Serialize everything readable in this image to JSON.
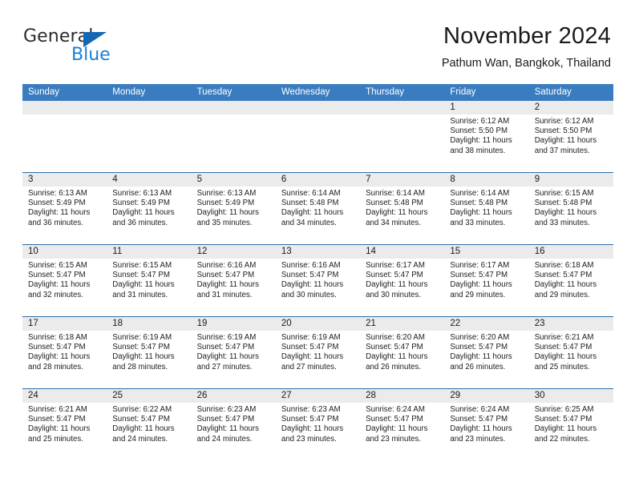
{
  "brand": {
    "name_top": "General",
    "name_bottom": "Blue",
    "accent_color": "#1b7fd4",
    "triangle_color": "#1268b3"
  },
  "header": {
    "title": "November 2024",
    "subtitle": "Pathum Wan, Bangkok, Thailand"
  },
  "calendar": {
    "header_bg": "#3a7cc0",
    "daynum_bg": "#ebebeb",
    "weekdays": [
      "Sunday",
      "Monday",
      "Tuesday",
      "Wednesday",
      "Thursday",
      "Friday",
      "Saturday"
    ],
    "weeks": [
      [
        {
          "day": "",
          "empty": true,
          "sunrise": "",
          "sunset": "",
          "daylight": ""
        },
        {
          "day": "",
          "empty": true,
          "sunrise": "",
          "sunset": "",
          "daylight": ""
        },
        {
          "day": "",
          "empty": true,
          "sunrise": "",
          "sunset": "",
          "daylight": ""
        },
        {
          "day": "",
          "empty": true,
          "sunrise": "",
          "sunset": "",
          "daylight": ""
        },
        {
          "day": "",
          "empty": true,
          "sunrise": "",
          "sunset": "",
          "daylight": ""
        },
        {
          "day": "1",
          "empty": false,
          "sunrise": "Sunrise: 6:12 AM",
          "sunset": "Sunset: 5:50 PM",
          "daylight": "Daylight: 11 hours and 38 minutes."
        },
        {
          "day": "2",
          "empty": false,
          "sunrise": "Sunrise: 6:12 AM",
          "sunset": "Sunset: 5:50 PM",
          "daylight": "Daylight: 11 hours and 37 minutes."
        }
      ],
      [
        {
          "day": "3",
          "empty": false,
          "sunrise": "Sunrise: 6:13 AM",
          "sunset": "Sunset: 5:49 PM",
          "daylight": "Daylight: 11 hours and 36 minutes."
        },
        {
          "day": "4",
          "empty": false,
          "sunrise": "Sunrise: 6:13 AM",
          "sunset": "Sunset: 5:49 PM",
          "daylight": "Daylight: 11 hours and 36 minutes."
        },
        {
          "day": "5",
          "empty": false,
          "sunrise": "Sunrise: 6:13 AM",
          "sunset": "Sunset: 5:49 PM",
          "daylight": "Daylight: 11 hours and 35 minutes."
        },
        {
          "day": "6",
          "empty": false,
          "sunrise": "Sunrise: 6:14 AM",
          "sunset": "Sunset: 5:48 PM",
          "daylight": "Daylight: 11 hours and 34 minutes."
        },
        {
          "day": "7",
          "empty": false,
          "sunrise": "Sunrise: 6:14 AM",
          "sunset": "Sunset: 5:48 PM",
          "daylight": "Daylight: 11 hours and 34 minutes."
        },
        {
          "day": "8",
          "empty": false,
          "sunrise": "Sunrise: 6:14 AM",
          "sunset": "Sunset: 5:48 PM",
          "daylight": "Daylight: 11 hours and 33 minutes."
        },
        {
          "day": "9",
          "empty": false,
          "sunrise": "Sunrise: 6:15 AM",
          "sunset": "Sunset: 5:48 PM",
          "daylight": "Daylight: 11 hours and 33 minutes."
        }
      ],
      [
        {
          "day": "10",
          "empty": false,
          "sunrise": "Sunrise: 6:15 AM",
          "sunset": "Sunset: 5:47 PM",
          "daylight": "Daylight: 11 hours and 32 minutes."
        },
        {
          "day": "11",
          "empty": false,
          "sunrise": "Sunrise: 6:15 AM",
          "sunset": "Sunset: 5:47 PM",
          "daylight": "Daylight: 11 hours and 31 minutes."
        },
        {
          "day": "12",
          "empty": false,
          "sunrise": "Sunrise: 6:16 AM",
          "sunset": "Sunset: 5:47 PM",
          "daylight": "Daylight: 11 hours and 31 minutes."
        },
        {
          "day": "13",
          "empty": false,
          "sunrise": "Sunrise: 6:16 AM",
          "sunset": "Sunset: 5:47 PM",
          "daylight": "Daylight: 11 hours and 30 minutes."
        },
        {
          "day": "14",
          "empty": false,
          "sunrise": "Sunrise: 6:17 AM",
          "sunset": "Sunset: 5:47 PM",
          "daylight": "Daylight: 11 hours and 30 minutes."
        },
        {
          "day": "15",
          "empty": false,
          "sunrise": "Sunrise: 6:17 AM",
          "sunset": "Sunset: 5:47 PM",
          "daylight": "Daylight: 11 hours and 29 minutes."
        },
        {
          "day": "16",
          "empty": false,
          "sunrise": "Sunrise: 6:18 AM",
          "sunset": "Sunset: 5:47 PM",
          "daylight": "Daylight: 11 hours and 29 minutes."
        }
      ],
      [
        {
          "day": "17",
          "empty": false,
          "sunrise": "Sunrise: 6:18 AM",
          "sunset": "Sunset: 5:47 PM",
          "daylight": "Daylight: 11 hours and 28 minutes."
        },
        {
          "day": "18",
          "empty": false,
          "sunrise": "Sunrise: 6:19 AM",
          "sunset": "Sunset: 5:47 PM",
          "daylight": "Daylight: 11 hours and 28 minutes."
        },
        {
          "day": "19",
          "empty": false,
          "sunrise": "Sunrise: 6:19 AM",
          "sunset": "Sunset: 5:47 PM",
          "daylight": "Daylight: 11 hours and 27 minutes."
        },
        {
          "day": "20",
          "empty": false,
          "sunrise": "Sunrise: 6:19 AM",
          "sunset": "Sunset: 5:47 PM",
          "daylight": "Daylight: 11 hours and 27 minutes."
        },
        {
          "day": "21",
          "empty": false,
          "sunrise": "Sunrise: 6:20 AM",
          "sunset": "Sunset: 5:47 PM",
          "daylight": "Daylight: 11 hours and 26 minutes."
        },
        {
          "day": "22",
          "empty": false,
          "sunrise": "Sunrise: 6:20 AM",
          "sunset": "Sunset: 5:47 PM",
          "daylight": "Daylight: 11 hours and 26 minutes."
        },
        {
          "day": "23",
          "empty": false,
          "sunrise": "Sunrise: 6:21 AM",
          "sunset": "Sunset: 5:47 PM",
          "daylight": "Daylight: 11 hours and 25 minutes."
        }
      ],
      [
        {
          "day": "24",
          "empty": false,
          "sunrise": "Sunrise: 6:21 AM",
          "sunset": "Sunset: 5:47 PM",
          "daylight": "Daylight: 11 hours and 25 minutes."
        },
        {
          "day": "25",
          "empty": false,
          "sunrise": "Sunrise: 6:22 AM",
          "sunset": "Sunset: 5:47 PM",
          "daylight": "Daylight: 11 hours and 24 minutes."
        },
        {
          "day": "26",
          "empty": false,
          "sunrise": "Sunrise: 6:23 AM",
          "sunset": "Sunset: 5:47 PM",
          "daylight": "Daylight: 11 hours and 24 minutes."
        },
        {
          "day": "27",
          "empty": false,
          "sunrise": "Sunrise: 6:23 AM",
          "sunset": "Sunset: 5:47 PM",
          "daylight": "Daylight: 11 hours and 23 minutes."
        },
        {
          "day": "28",
          "empty": false,
          "sunrise": "Sunrise: 6:24 AM",
          "sunset": "Sunset: 5:47 PM",
          "daylight": "Daylight: 11 hours and 23 minutes."
        },
        {
          "day": "29",
          "empty": false,
          "sunrise": "Sunrise: 6:24 AM",
          "sunset": "Sunset: 5:47 PM",
          "daylight": "Daylight: 11 hours and 23 minutes."
        },
        {
          "day": "30",
          "empty": false,
          "sunrise": "Sunrise: 6:25 AM",
          "sunset": "Sunset: 5:47 PM",
          "daylight": "Daylight: 11 hours and 22 minutes."
        }
      ]
    ]
  }
}
